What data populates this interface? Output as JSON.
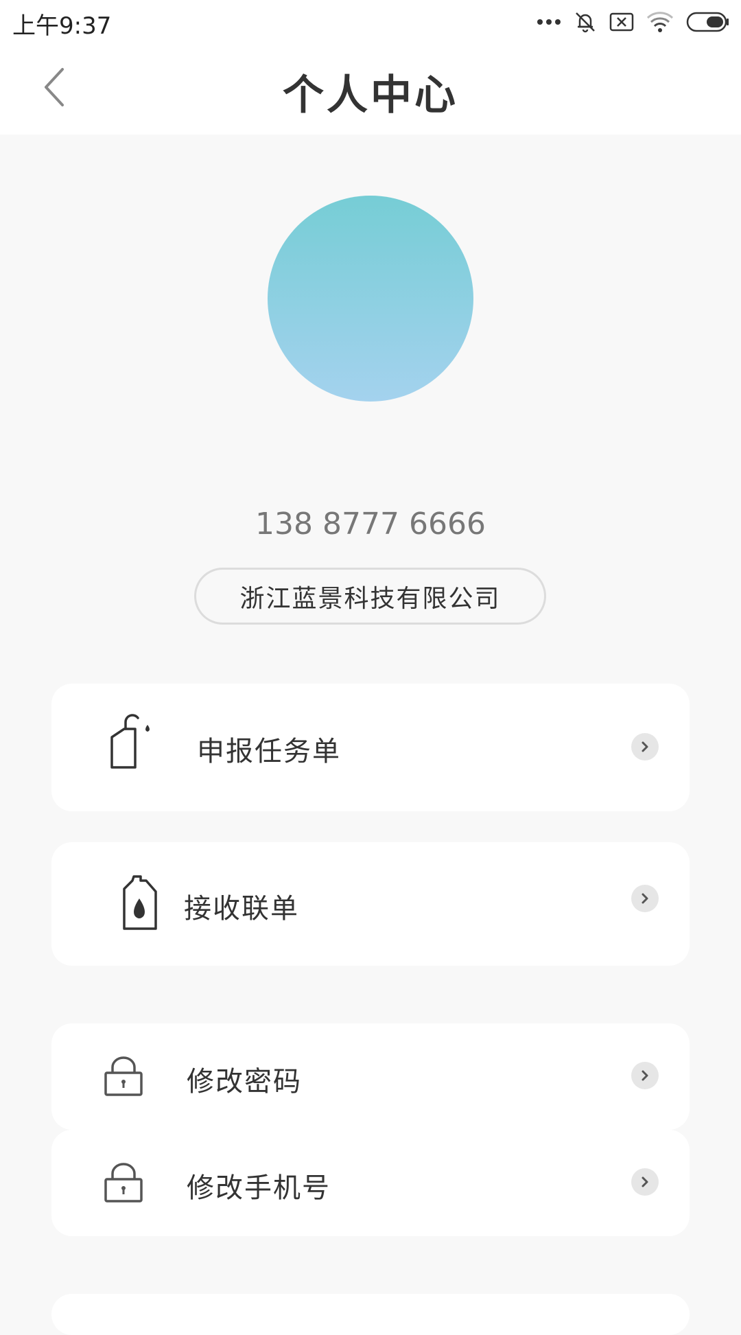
{
  "status_bar": {
    "time": "上午9:37",
    "icons": [
      "more-dots-icon",
      "mute-bell-icon",
      "sim-x-icon",
      "wifi-icon",
      "battery-icon"
    ]
  },
  "header": {
    "title": "个人中心",
    "back_icon": "chevron-left-icon"
  },
  "profile": {
    "avatar_gradient": [
      "#76cdd5",
      "#a4d2ee"
    ],
    "phone": "138 8777 6666",
    "company": "浙江蓝景科技有限公司"
  },
  "menu": {
    "items": [
      {
        "label": "申报任务单",
        "icon": "spray-bottle-icon"
      },
      {
        "label": "接收联单",
        "icon": "oil-canister-icon"
      },
      {
        "label": "修改密码",
        "icon": "lock-icon"
      },
      {
        "label": "修改手机号",
        "icon": "lock-icon"
      }
    ]
  },
  "colors": {
    "background": "#f8f8f8",
    "card": "#ffffff",
    "text": "#333333",
    "subtext": "#777777"
  }
}
